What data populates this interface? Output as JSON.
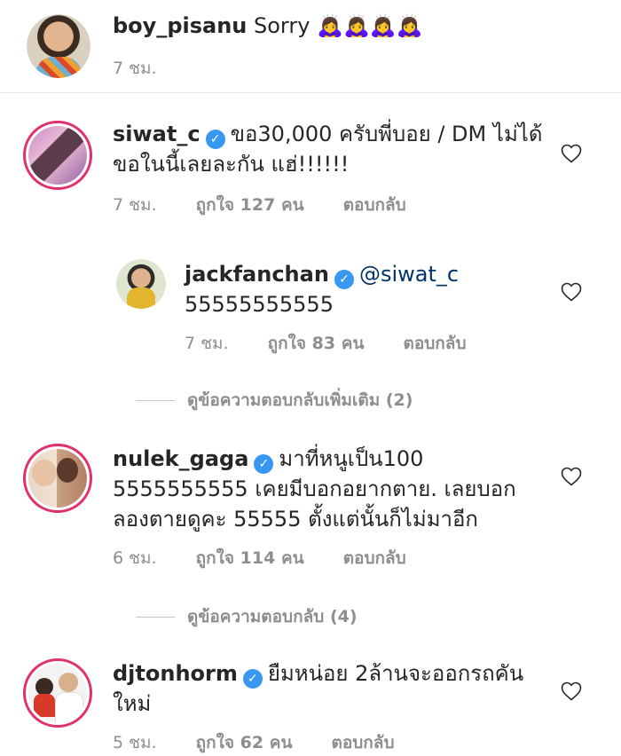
{
  "caption": {
    "username": "boy_pisanu",
    "text": "Sorry 🙇‍♀️🙇‍♀️🙇‍♀️🙇‍♀️",
    "time": "7 ชม."
  },
  "comments": [
    {
      "username": "siwat_c",
      "verified": true,
      "text": "ขอ30,000 ครับพี่บอย / DM ไม่ได้ ขอในนี้เลยละกัน แฮ่!!!!!!",
      "time": "7 ชม.",
      "likes": "ถูกใจ 127 คน",
      "reply": "ตอบกลับ"
    },
    {
      "username": "jackfanchan",
      "verified": true,
      "mention": "@siwat_c",
      "text": "55555555555",
      "time": "7 ชม.",
      "likes": "ถูกใจ 83 คน",
      "reply": "ตอบกลับ"
    },
    {
      "username": "nulek_gaga",
      "verified": true,
      "text": "มาที่หนูเป็น100 5555555555 เคยมีบอกอยากตาย. เลยบอกลองตายดูคะ 55555 ตั้งแต่นั้นก็ไม่มาอีก",
      "time": "6 ชม.",
      "likes": "ถูกใจ 114 คน",
      "reply": "ตอบกลับ"
    },
    {
      "username": "djtonhorm",
      "verified": true,
      "text": "ยืมหน่อย 2ล้านจะออกรถคันใหม่",
      "time": "5 ชม.",
      "likes": "ถูกใจ 62 คน",
      "reply": "ตอบกลับ"
    }
  ],
  "more_replies": [
    "ดูข้อความตอบกลับเพิ่มเติม (2)",
    "ดูข้อความตอบกลับ (4)"
  ],
  "icons": {
    "heart": "heart-icon",
    "verified": "verified-badge-icon"
  },
  "colors": {
    "verified": "#3897f0",
    "story_ring": "#e1306c",
    "meta_text": "#8e8e8e",
    "mention": "#003569"
  }
}
